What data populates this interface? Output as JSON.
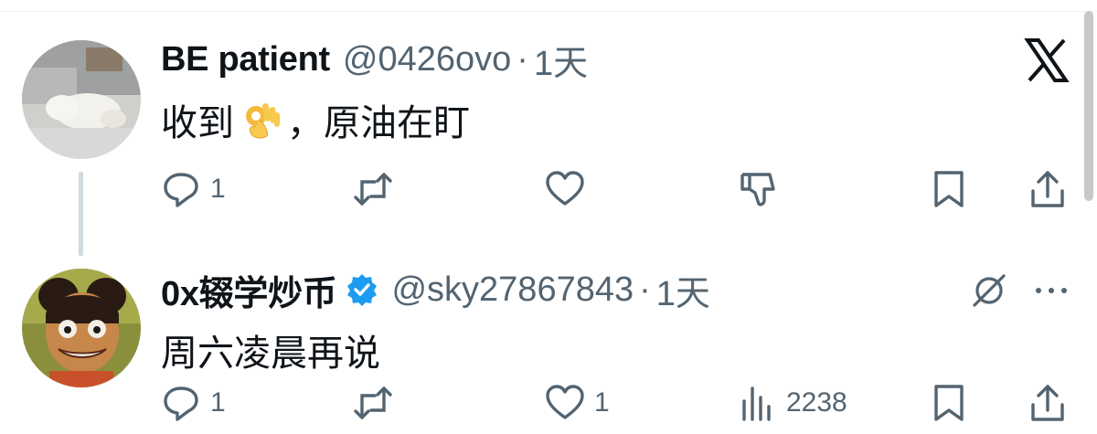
{
  "posts": [
    {
      "display_name": "BE patient",
      "handle": "@0426ovo",
      "separator": "·",
      "time": "1天",
      "text_before_emoji": "收到",
      "emoji": "ok-hand-emoji",
      "text_after_emoji": "，原油在盯",
      "actions": {
        "reply_count": "1",
        "retweet_count": "",
        "like_count": "",
        "view_count": ""
      },
      "icons": [
        "reply-icon",
        "retweet-icon",
        "like-icon",
        "dislike-icon",
        "bookmark-icon",
        "share-icon",
        "x-logo-icon"
      ]
    },
    {
      "display_name": "0x辍学炒币",
      "verified": true,
      "handle": "@sky27867843",
      "separator": "·",
      "time": "1天",
      "text": "周六凌晨再说",
      "actions": {
        "reply_count": "1",
        "retweet_count": "",
        "like_count": "1",
        "view_count": "2238"
      },
      "icons": [
        "reply-icon",
        "retweet-icon",
        "like-icon",
        "views-icon",
        "bookmark-icon",
        "share-icon",
        "grok-icon",
        "more-icon"
      ]
    }
  ],
  "colors": {
    "text": "#0f1419",
    "secondary": "#536471",
    "verified_blue": "#1d9bf0",
    "thread_line": "#cfd9de"
  }
}
